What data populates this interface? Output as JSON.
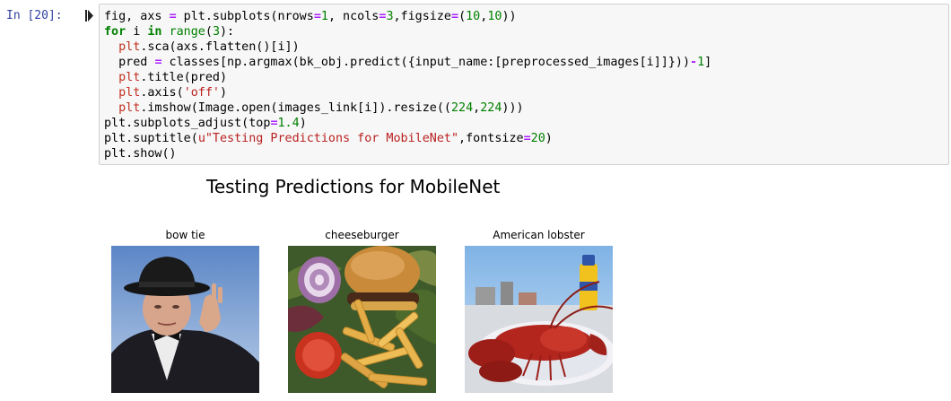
{
  "cell": {
    "prompt": "In [20]:",
    "code_lines": [
      "fig, axs = plt.subplots(nrows=1, ncols=3,figsize=(10,10))",
      "for i in range(3):",
      "  plt.sca(axs.flatten()[i])",
      "  pred = classes[np.argmax(bk_obj.predict({input_name:[preprocessed_images[i]]}))-1]",
      "  plt.title(pred)",
      "  plt.axis('off')",
      "  plt.imshow(Image.open(images_link[i]).resize((224,224)))",
      "plt.subplots_adjust(top=1.4)",
      "plt.suptitle(u\"Testing Predictions for MobileNet\",fontsize=20)",
      "plt.show()"
    ]
  },
  "output": {
    "suptitle": "Testing Predictions for MobileNet",
    "subplots": [
      {
        "title": "bow tie",
        "image": "man-in-bowler-hat-photo"
      },
      {
        "title": "cheeseburger",
        "image": "cheeseburger-with-fries-photo"
      },
      {
        "title": "American lobster",
        "image": "cooked-lobster-on-plate-photo"
      }
    ]
  }
}
